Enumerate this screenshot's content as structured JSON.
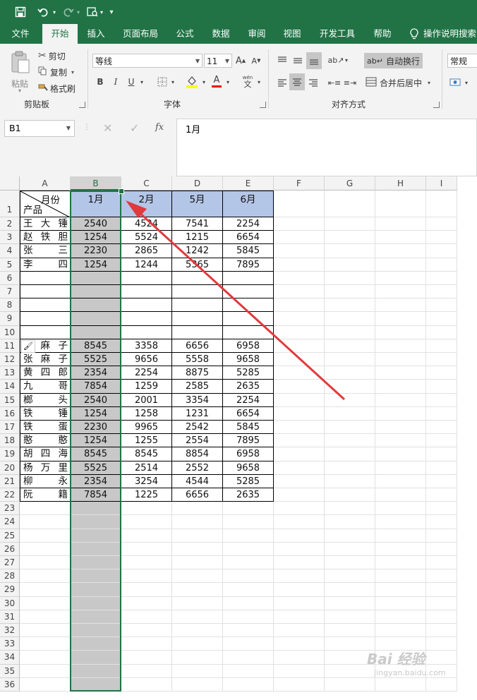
{
  "toolbar": {
    "undo_tooltip": "",
    "more": "▾"
  },
  "tabs": [
    "文件",
    "开始",
    "插入",
    "页面布局",
    "公式",
    "数据",
    "审阅",
    "视图",
    "开发工具",
    "帮助"
  ],
  "tell_me": "操作说明搜索",
  "ribbon": {
    "paste": "粘贴",
    "cut": "剪切",
    "copy": "复制",
    "format_painter": "格式刷",
    "clipboard_group": "剪贴板",
    "font_name": "等线",
    "font_size": "11",
    "grow_font": "A",
    "shrink_font": "A",
    "bold": "B",
    "italic": "I",
    "underline": "U",
    "font_color_letter": "A",
    "phonetic": "wén",
    "phonetic_char": "文",
    "font_group": "字体",
    "wrap_text": "自动换行",
    "merge_center": "合并后居中",
    "alignment_group": "对齐方式",
    "number_format": "常规"
  },
  "formula_bar": {
    "name_box": "B1",
    "fx": "fx",
    "content": "1月"
  },
  "columns": [
    "A",
    "B",
    "C",
    "D",
    "E",
    "F",
    "G",
    "H",
    "I"
  ],
  "header_row": {
    "diag_top": "月份",
    "diag_bottom": "产品",
    "months": [
      "1月",
      "2月",
      "5月",
      "6月"
    ]
  },
  "rows": [
    {
      "row": 2,
      "name": [
        "王",
        "大",
        "锤"
      ],
      "values": [
        "2540",
        "4524",
        "7541",
        "2254"
      ]
    },
    {
      "row": 3,
      "name": [
        "赵",
        "铁",
        "胆"
      ],
      "values": [
        "1254",
        "5524",
        "1215",
        "6654"
      ]
    },
    {
      "row": 4,
      "name": [
        "张",
        "",
        "三"
      ],
      "values": [
        "2230",
        "2865",
        "1242",
        "5845"
      ]
    },
    {
      "row": 5,
      "name": [
        "李",
        "",
        "四"
      ],
      "values": [
        "1254",
        "1244",
        "5365",
        "7895"
      ]
    },
    {
      "row": 11,
      "name": [
        "",
        "麻",
        "子"
      ],
      "values": [
        "8545",
        "3358",
        "6656",
        "6958"
      ]
    },
    {
      "row": 12,
      "name": [
        "张",
        "麻",
        "子"
      ],
      "values": [
        "5525",
        "9656",
        "5558",
        "9658"
      ]
    },
    {
      "row": 13,
      "name": [
        "黄",
        "四",
        "郎"
      ],
      "values": [
        "2354",
        "2254",
        "8875",
        "5285"
      ]
    },
    {
      "row": 14,
      "name": [
        "九",
        "",
        "哥"
      ],
      "values": [
        "7854",
        "1259",
        "2585",
        "2635"
      ]
    },
    {
      "row": 15,
      "name": [
        "榔",
        "",
        "头"
      ],
      "values": [
        "2540",
        "2001",
        "3354",
        "2254"
      ]
    },
    {
      "row": 16,
      "name": [
        "铁",
        "",
        "锤"
      ],
      "values": [
        "1254",
        "1258",
        "1231",
        "6654"
      ]
    },
    {
      "row": 17,
      "name": [
        "铁",
        "",
        "蛋"
      ],
      "values": [
        "2230",
        "9965",
        "2542",
        "5845"
      ]
    },
    {
      "row": 18,
      "name": [
        "憨",
        "",
        "憨"
      ],
      "values": [
        "1254",
        "1255",
        "2554",
        "7895"
      ]
    },
    {
      "row": 19,
      "name": [
        "胡",
        "四",
        "海"
      ],
      "values": [
        "8545",
        "8545",
        "8854",
        "6958"
      ]
    },
    {
      "row": 20,
      "name": [
        "杨",
        "万",
        "里"
      ],
      "values": [
        "5525",
        "2514",
        "2552",
        "9658"
      ]
    },
    {
      "row": 21,
      "name": [
        "柳",
        "",
        "永"
      ],
      "values": [
        "2354",
        "3254",
        "4544",
        "5285"
      ]
    },
    {
      "row": 22,
      "name": [
        "阮",
        "",
        "籍"
      ],
      "values": [
        "7854",
        "1225",
        "6656",
        "2635"
      ]
    }
  ],
  "row_numbers": [
    "1",
    "2",
    "3",
    "4",
    "5",
    "6",
    "7",
    "8",
    "9",
    "10",
    "11",
    "12",
    "13",
    "14",
    "15",
    "16",
    "17",
    "18",
    "19",
    "20",
    "21",
    "22",
    "23",
    "24",
    "25",
    "26",
    "27",
    "28",
    "29",
    "30",
    "31",
    "32",
    "33",
    "34",
    "35",
    "36"
  ],
  "watermark": {
    "text": "Bai 经验",
    "url": "jingyan.baidu.com"
  },
  "colors": {
    "accent": "#217346",
    "header_fill": "#b4c6e7",
    "selection": "#c8c8c8",
    "arrow": "#e0393e"
  }
}
